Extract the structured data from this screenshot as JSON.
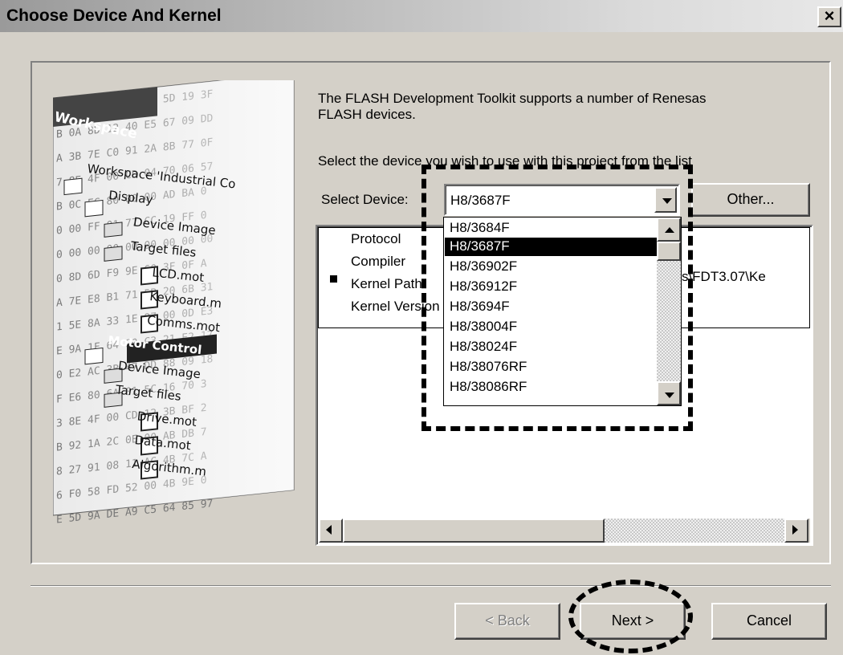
{
  "window": {
    "title": "Choose Device And Kernel",
    "close_label": "×"
  },
  "intro_line1": "The FLASH Development Toolkit supports a number of Renesas",
  "intro_line2": "FLASH devices.",
  "instruction": "Select the device you wish to use with this project from the list",
  "select_device": {
    "label": "Select Device:",
    "value": "H8/3687F",
    "other_button": "Other...",
    "options": [
      "H8/3684F",
      "H8/3687F",
      "H8/36902F",
      "H8/36912F",
      "H8/3694F",
      "H8/38004F",
      "H8/38024F",
      "H8/38076RF",
      "H8/38086RF"
    ],
    "selected_option": "H8/3687F"
  },
  "info": {
    "labels": [
      "Protocol",
      "Compiler",
      "Kernel Path",
      "Kernel Version"
    ],
    "kernel_path_tail": "sas\\FDT3.07\\Ke"
  },
  "illustration": {
    "workspace_tab": "Workspace",
    "tree": [
      "Workspace 'Industrial Co",
      "Display",
      "Device Image",
      "Target files",
      "LCD.mot",
      "Keyboard.m",
      "Comms.mot",
      "Motor Control",
      "Device Image",
      "Target files",
      "Drive.mot",
      "Data.mot",
      "Algorithm.m"
    ]
  },
  "buttons": {
    "back": "< Back",
    "next": "Next >",
    "cancel": "Cancel"
  },
  "colors": {
    "dialog_bg": "#d4d0c8",
    "selection": "#000000"
  }
}
